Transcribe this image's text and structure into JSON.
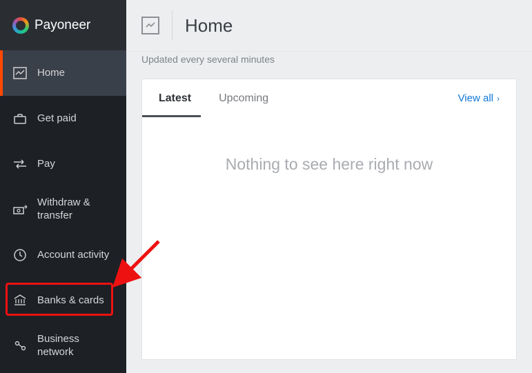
{
  "brand": "Payoneer",
  "sidebar": {
    "items": [
      {
        "label": "Home",
        "icon": "chart-window-icon",
        "active": true
      },
      {
        "label": "Get paid",
        "icon": "briefcase-icon"
      },
      {
        "label": "Pay",
        "icon": "transfer-arrows-icon"
      },
      {
        "label": "Withdraw & transfer",
        "icon": "cash-out-icon"
      },
      {
        "label": "Account activity",
        "icon": "clock-icon"
      },
      {
        "label": "Banks & cards",
        "icon": "bank-card-icon",
        "highlighted": true
      },
      {
        "label": "Business network",
        "icon": "people-share-icon"
      }
    ]
  },
  "topbar": {
    "title": "Home"
  },
  "section": {
    "truncated_heading": "",
    "updated_text": "Updated every several minutes"
  },
  "tabs": {
    "items": [
      {
        "label": "Latest",
        "active": true
      },
      {
        "label": "Upcoming"
      }
    ],
    "view_all": "View all"
  },
  "empty_state": "Nothing to see here right now",
  "colors": {
    "sidebar_bg": "#1d2025",
    "active_bg": "#3a4049",
    "accent": "#ff4800",
    "link": "#0f77d6",
    "highlight": "#e11"
  }
}
